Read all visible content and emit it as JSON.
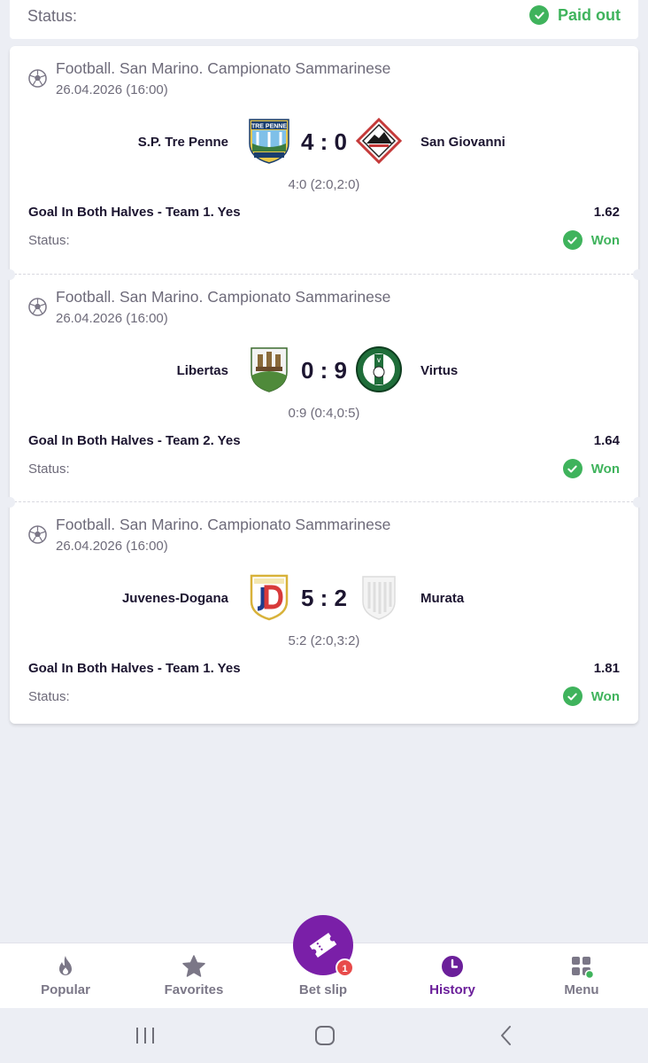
{
  "summary": {
    "status_label": "Status:",
    "status_value": "Paid out",
    "status_color": "#3fb35c"
  },
  "events": [
    {
      "league": "Football. San Marino. Campionato Sammarinese",
      "date": "26.04.2026 (16:00)",
      "team1": "S.P. Tre Penne",
      "team2": "San Giovanni",
      "score": "4 : 0",
      "score_detail": "4:0 (2:0,2:0)",
      "market": "Goal In Both Halves - Team 1. Yes",
      "odds": "1.62",
      "status_label": "Status:",
      "status_value": "Won",
      "team1_logo_icon": "tre-penne-crest-icon",
      "team2_logo_icon": "san-giovanni-crest-icon"
    },
    {
      "league": "Football. San Marino. Campionato Sammarinese",
      "date": "26.04.2026 (16:00)",
      "team1": "Libertas",
      "team2": "Virtus",
      "score": "0 : 9",
      "score_detail": "0:9 (0:4,0:5)",
      "market": "Goal In Both Halves - Team 2. Yes",
      "odds": "1.64",
      "status_label": "Status:",
      "status_value": "Won",
      "team1_logo_icon": "libertas-crest-icon",
      "team2_logo_icon": "virtus-crest-icon"
    },
    {
      "league": "Football. San Marino. Campionato Sammarinese",
      "date": "26.04.2026 (16:00)",
      "team1": "Juvenes-Dogana",
      "team2": "Murata",
      "score": "5 : 2",
      "score_detail": "5:2 (2:0,3:2)",
      "market": "Goal In Both Halves - Team 1. Yes",
      "odds": "1.81",
      "status_label": "Status:",
      "status_value": "Won",
      "team1_logo_icon": "juvenes-dogana-crest-icon",
      "team2_logo_icon": "murata-crest-icon"
    }
  ],
  "bottom_nav": {
    "items": [
      {
        "label": "Popular",
        "icon": "flame-icon"
      },
      {
        "label": "Favorites",
        "icon": "star-icon"
      },
      {
        "label": "Bet slip",
        "icon": "ticket-icon",
        "badge": "1"
      },
      {
        "label": "History",
        "icon": "clock-icon",
        "active": true
      },
      {
        "label": "Menu",
        "icon": "grid-menu-icon"
      }
    ]
  },
  "colors": {
    "accent": "#6b1f9a",
    "success": "#3fb35c",
    "badge": "#e84b4b"
  }
}
